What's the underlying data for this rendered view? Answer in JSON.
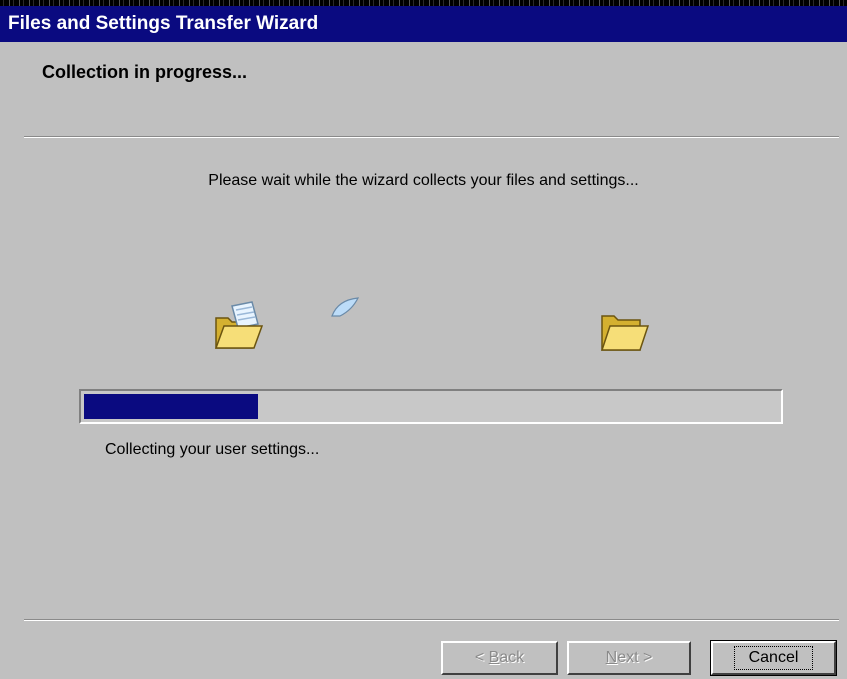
{
  "window": {
    "title": "Files and Settings Transfer Wizard"
  },
  "header": {
    "title": "Collection in progress..."
  },
  "main": {
    "message": "Please wait while the wizard collects your files and settings...",
    "progress_percent": 25,
    "status": "Collecting your user settings...",
    "icons": {
      "source": "open-folder-with-document-icon",
      "flying": "flying-document-icon",
      "destination": "open-folder-icon"
    }
  },
  "buttons": {
    "back": {
      "accel": "B",
      "rest": "ack",
      "prefix": "< "
    },
    "next": {
      "accel": "N",
      "rest": "ext",
      "suffix": " >"
    },
    "cancel": "Cancel"
  },
  "colors": {
    "titlebar": "#0a0a80",
    "progress": "#0a0a80",
    "dialog": "#c0c0c0"
  }
}
